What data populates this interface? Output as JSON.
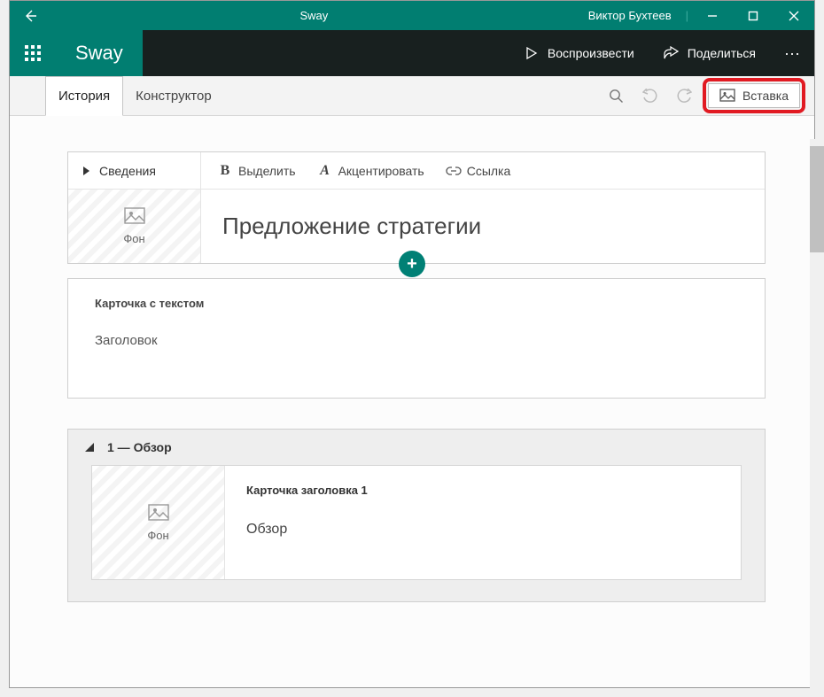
{
  "titlebar": {
    "app_name": "Sway",
    "user_name": "Виктор Бухтеев"
  },
  "ribbon": {
    "logo": "Sway",
    "play_label": "Воспроизвести",
    "share_label": "Поделиться"
  },
  "tabs": {
    "story": "История",
    "design": "Конструктор",
    "insert": "Вставка"
  },
  "card1": {
    "details_label": "Сведения",
    "bg_label": "Фон",
    "bold_label": "Выделить",
    "emphasis_label": "Акцентировать",
    "link_label": "Ссылка",
    "title_text": "Предложение стратегии"
  },
  "text_card": {
    "label": "Карточка с текстом",
    "placeholder": "Заголовок"
  },
  "section1": {
    "header": "1 — Обзор",
    "sub_label": "Карточка заголовка 1",
    "sub_text": "Обзор",
    "bg_label": "Фон"
  }
}
